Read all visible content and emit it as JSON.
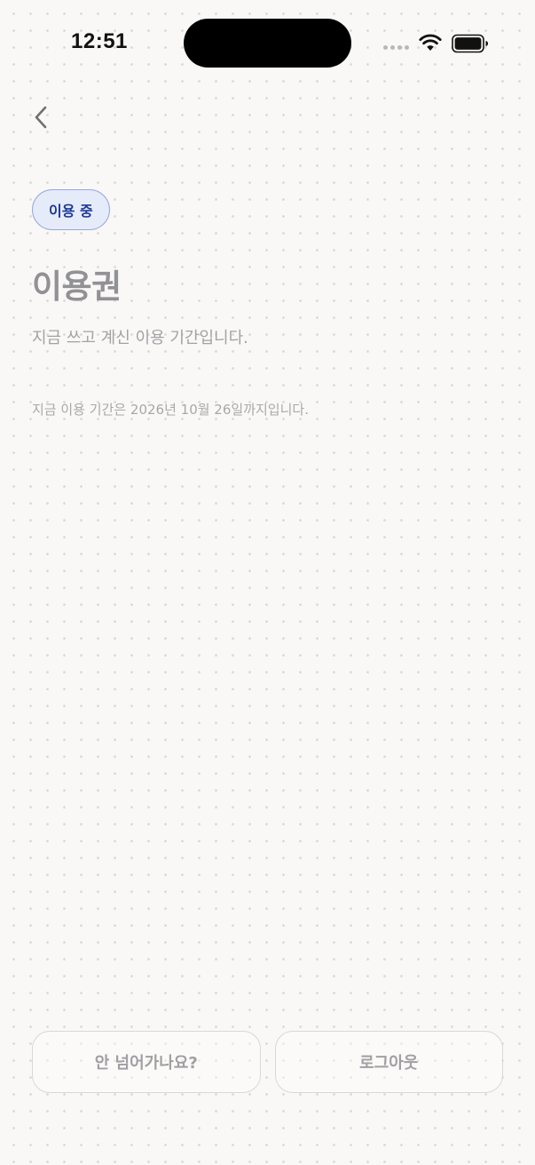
{
  "status_bar": {
    "time": "12:51",
    "icons": [
      "signal-dots-icon",
      "wifi-icon",
      "battery-icon"
    ]
  },
  "nav": {
    "back_icon": "chevron-left-icon"
  },
  "badge": {
    "label": "이용 중",
    "colors": {
      "border": "#97a8dc",
      "background": "#e6ebfa",
      "text": "#1c3a95"
    }
  },
  "main": {
    "title": "이용권",
    "subtitle": "지금 쓰고 계신 이용 기간입니다.",
    "expiry_text": "지금 이용 기간은 2026년 10월 26일까지입니다."
  },
  "actions": {
    "help_label": "안 넘어가나요?",
    "logout_label": "로그아웃"
  }
}
